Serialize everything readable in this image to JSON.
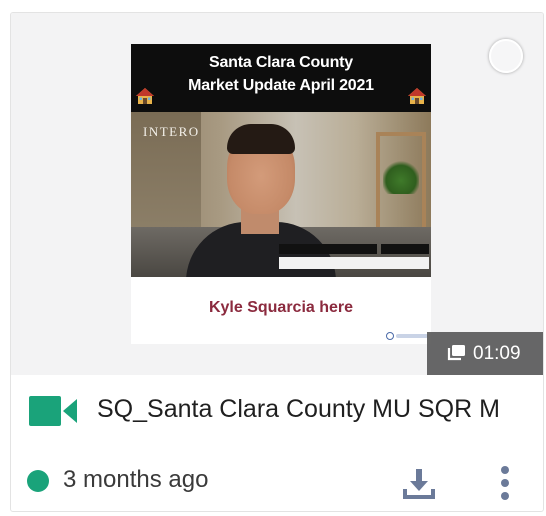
{
  "thumbnail": {
    "banner_line1": "Santa Clara County",
    "banner_line2": "Market Update April 2021",
    "watermark": "INTERO",
    "caption": "Kyle Squarcia here",
    "duration": "01:09"
  },
  "item": {
    "title": "SQ_Santa Clara County MU SQR M",
    "age": "3 months ago"
  },
  "icons": {
    "select": "selection-circle-icon",
    "house": "house-emoji-icon",
    "duration": "stack-icon",
    "type": "video-camera-icon",
    "status": "status-dot-icon",
    "download": "download-icon",
    "more": "more-vertical-icon"
  },
  "colors": {
    "video_icon": "#1aa37a",
    "status_dot": "#1aa37a",
    "action_icons": "#6b7a99",
    "caption": "#8b2a3e",
    "badge_bg": "#5a5a5a"
  }
}
